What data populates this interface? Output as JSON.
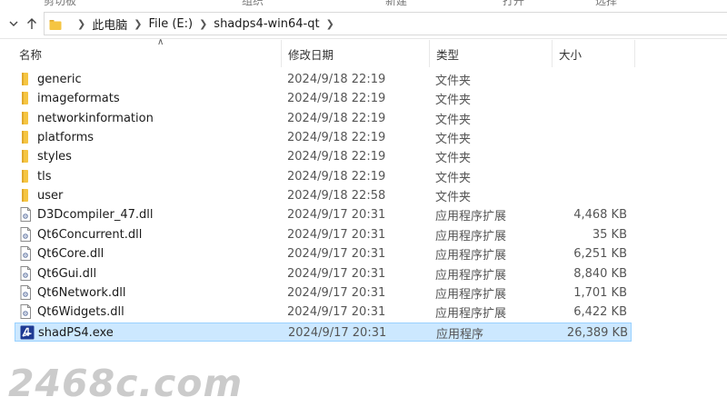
{
  "ribbon": {
    "items": [
      "剪切板",
      "组织",
      "新建",
      "打开",
      "选择"
    ]
  },
  "address": {
    "crumbs": [
      "此电脑",
      "File (E:)",
      "shadps4-win64-qt"
    ]
  },
  "columns": {
    "name": "名称",
    "date": "修改日期",
    "type": "类型",
    "size": "大小"
  },
  "files": [
    {
      "name": "generic",
      "date": "2024/9/18 22:19",
      "type": "文件夹",
      "size": "",
      "kind": "folder-icon"
    },
    {
      "name": "imageformats",
      "date": "2024/9/18 22:19",
      "type": "文件夹",
      "size": "",
      "kind": "folder-icon"
    },
    {
      "name": "networkinformation",
      "date": "2024/9/18 22:19",
      "type": "文件夹",
      "size": "",
      "kind": "folder-icon"
    },
    {
      "name": "platforms",
      "date": "2024/9/18 22:19",
      "type": "文件夹",
      "size": "",
      "kind": "folder-icon"
    },
    {
      "name": "styles",
      "date": "2024/9/18 22:19",
      "type": "文件夹",
      "size": "",
      "kind": "folder-icon"
    },
    {
      "name": "tls",
      "date": "2024/9/18 22:19",
      "type": "文件夹",
      "size": "",
      "kind": "folder-icon"
    },
    {
      "name": "user",
      "date": "2024/9/18 22:58",
      "type": "文件夹",
      "size": "",
      "kind": "folder-icon"
    },
    {
      "name": "D3Dcompiler_47.dll",
      "date": "2024/9/17 20:31",
      "type": "应用程序扩展",
      "size": "4,468 KB",
      "kind": "dll-file-icon"
    },
    {
      "name": "Qt6Concurrent.dll",
      "date": "2024/9/17 20:31",
      "type": "应用程序扩展",
      "size": "35 KB",
      "kind": "dll-file-icon"
    },
    {
      "name": "Qt6Core.dll",
      "date": "2024/9/17 20:31",
      "type": "应用程序扩展",
      "size": "6,251 KB",
      "kind": "dll-file-icon"
    },
    {
      "name": "Qt6Gui.dll",
      "date": "2024/9/17 20:31",
      "type": "应用程序扩展",
      "size": "8,840 KB",
      "kind": "dll-file-icon"
    },
    {
      "name": "Qt6Network.dll",
      "date": "2024/9/17 20:31",
      "type": "应用程序扩展",
      "size": "1,701 KB",
      "kind": "dll-file-icon"
    },
    {
      "name": "Qt6Widgets.dll",
      "date": "2024/9/17 20:31",
      "type": "应用程序扩展",
      "size": "6,422 KB",
      "kind": "dll-file-icon"
    },
    {
      "name": "shadPS4.exe",
      "date": "2024/9/17 20:31",
      "type": "应用程序",
      "size": "26,389 KB",
      "kind": "exe-app-icon",
      "selected": true
    }
  ],
  "watermark": "2468c.com",
  "colors": {
    "folder": "#f5c542",
    "selection": "#cce8ff",
    "selection_border": "#99d1ff"
  }
}
